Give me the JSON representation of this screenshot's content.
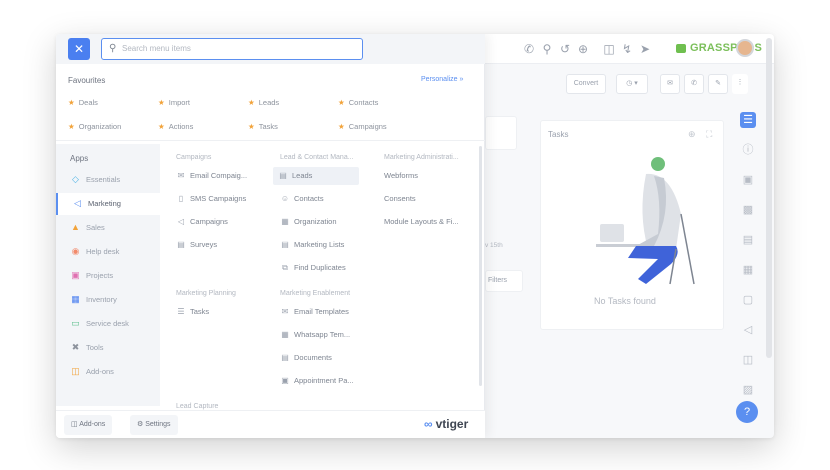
{
  "topbar": {
    "icons": [
      "phone-icon",
      "search-icon",
      "history-icon",
      "add-icon",
      "inbox-icon",
      "bolt-icon",
      "rocket-icon"
    ],
    "brand_text": "GRASSPODS"
  },
  "background": {
    "convert_label": "Convert",
    "tasks_title": "Tasks",
    "no_tasks": "No Tasks found",
    "filters_label": "Filters",
    "date_fragment": "v 15th"
  },
  "menu": {
    "search_placeholder": "Search menu items",
    "favourites_label": "Favourites",
    "personalize_label": "Personalize »",
    "favourites": [
      {
        "label": "Deals"
      },
      {
        "label": "Import"
      },
      {
        "label": "Leads"
      },
      {
        "label": "Contacts"
      },
      {
        "label": "Organization"
      },
      {
        "label": "Actions"
      },
      {
        "label": "Tasks"
      },
      {
        "label": "Campaigns"
      }
    ],
    "apps_title": "Apps",
    "apps": [
      {
        "label": "Essentials",
        "icon": "diamond-icon",
        "color": "#4db3e6"
      },
      {
        "label": "Marketing",
        "icon": "megaphone-icon",
        "color": "#5b8ff0"
      },
      {
        "label": "Sales",
        "icon": "sales-icon",
        "color": "#f2a33a"
      },
      {
        "label": "Help desk",
        "icon": "helpdesk-icon",
        "color": "#f28a6b"
      },
      {
        "label": "Projects",
        "icon": "projects-icon",
        "color": "#e06fb1"
      },
      {
        "label": "Inventory",
        "icon": "inventory-icon",
        "color": "#4a7ff0"
      },
      {
        "label": "Service desk",
        "icon": "service-icon",
        "color": "#5bbf8c"
      },
      {
        "label": "Tools",
        "icon": "tools-icon",
        "color": "#8d939d"
      },
      {
        "label": "Add-ons",
        "icon": "addons-icon",
        "color": "#f2a33a"
      }
    ],
    "columns": {
      "campaigns": {
        "heading": "Campaigns",
        "items": [
          {
            "label": "Email Compaig...",
            "icon": "email-campaign-icon"
          },
          {
            "label": "SMS Campaigns",
            "icon": "sms-icon"
          },
          {
            "label": "Campaigns",
            "icon": "campaign-icon"
          },
          {
            "label": "Surveys",
            "icon": "survey-icon"
          }
        ]
      },
      "lead_contact": {
        "heading": "Lead & Contact Mana...",
        "items": [
          {
            "label": "Leads",
            "icon": "leads-icon"
          },
          {
            "label": "Contacts",
            "icon": "contact-icon"
          },
          {
            "label": "Organization",
            "icon": "organization-icon"
          },
          {
            "label": "Marketing Lists",
            "icon": "list-icon"
          },
          {
            "label": "Find Duplicates",
            "icon": "duplicate-icon"
          }
        ]
      },
      "marketing_admin": {
        "heading": "Marketing Administrati...",
        "items": [
          {
            "label": "Webforms"
          },
          {
            "label": "Consents"
          },
          {
            "label": "Module Layouts & Fi..."
          }
        ]
      },
      "marketing_planning": {
        "heading": "Marketing Planning",
        "items": [
          {
            "label": "Tasks",
            "icon": "tasks-icon"
          }
        ]
      },
      "marketing_enablement": {
        "heading": "Marketing Enablement",
        "items": [
          {
            "label": "Email Templates",
            "icon": "template-icon"
          },
          {
            "label": "Whatsapp Tem...",
            "icon": "whatsapp-icon"
          },
          {
            "label": "Documents",
            "icon": "document-icon"
          },
          {
            "label": "Appointment Pa...",
            "icon": "calendar-icon"
          }
        ]
      },
      "lead_capture": {
        "heading": "Lead Capture"
      }
    },
    "footer": {
      "addons_label": "Add-ons",
      "settings_label": "Settings",
      "brand": "vtiger"
    }
  }
}
